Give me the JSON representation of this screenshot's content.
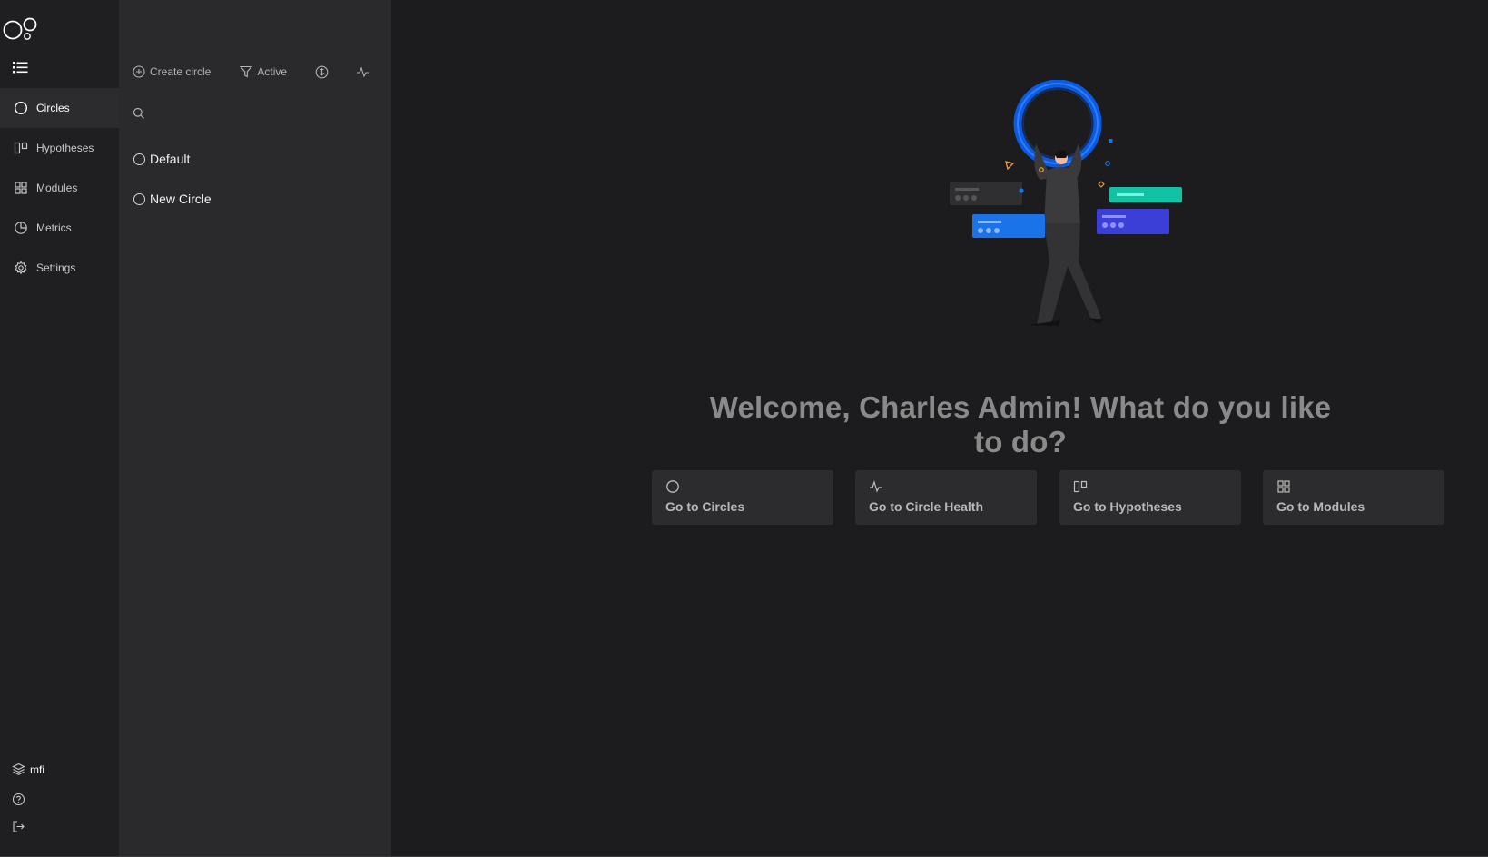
{
  "nav": {
    "items": [
      {
        "label": "Circles",
        "icon": "circle-icon",
        "active": true
      },
      {
        "label": "Hypotheses",
        "icon": "hypotheses-icon",
        "active": false
      },
      {
        "label": "Modules",
        "icon": "modules-grid-icon",
        "active": false
      },
      {
        "label": "Metrics",
        "icon": "pie-chart-icon",
        "active": false
      },
      {
        "label": "Settings",
        "icon": "gear-icon",
        "active": false
      }
    ],
    "workspace_label": "mfi",
    "help_icon": "help-icon",
    "logout_icon": "logout-icon"
  },
  "panel": {
    "create_label": "Create circle",
    "filter_label": "Active",
    "search_placeholder": "",
    "circles": [
      {
        "name": "Default"
      },
      {
        "name": "New Circle"
      }
    ]
  },
  "main": {
    "welcome": "Welcome, Charles Admin! What do you like to do?",
    "cards": [
      {
        "label": "Go to Circles",
        "icon": "circle-icon"
      },
      {
        "label": "Go to Circle Health",
        "icon": "pulse-icon"
      },
      {
        "label": "Go to Hypotheses",
        "icon": "hypotheses-icon"
      },
      {
        "label": "Go to Modules",
        "icon": "modules-grid-icon"
      }
    ]
  },
  "colors": {
    "background": "#1c1c1e",
    "nav_bg": "#1f1f21",
    "panel_bg": "#2a2a2c",
    "active_item": "#2c2c2e",
    "card_bg": "#2c2c2e",
    "accent_blue": "#1a73e8"
  }
}
